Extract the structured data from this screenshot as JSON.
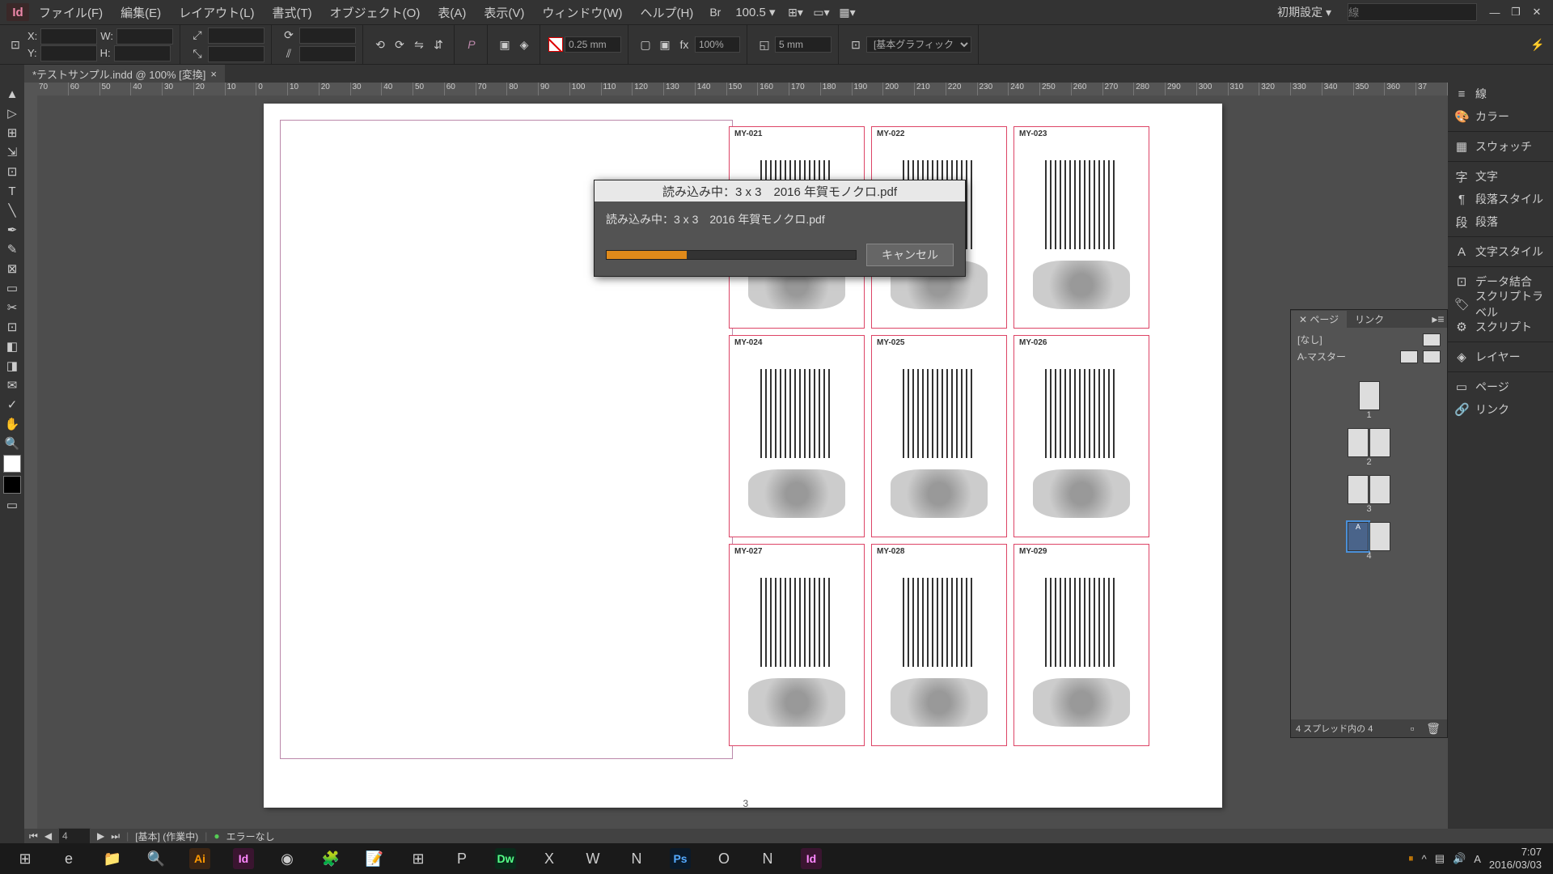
{
  "app": {
    "icon_label": "Id"
  },
  "menu": {
    "file": "ファイル(F)",
    "edit": "編集(E)",
    "layout": "レイアウト(L)",
    "type": "書式(T)",
    "object": "オブジェクト(O)",
    "table": "表(A)",
    "view": "表示(V)",
    "window": "ウィンドウ(W)",
    "help": "ヘルプ(H)"
  },
  "zoom": "100.5",
  "settings_label": "初期設定",
  "controls": {
    "stroke_val": "0.25 mm",
    "gap_val": "5 mm",
    "pct": "100%",
    "frame_style": "[基本グラフィックフ..."
  },
  "doc_tab": {
    "title": "*テストサンプル.indd @ 100% [変換]"
  },
  "ruler_marks": [
    "70",
    "60",
    "50",
    "40",
    "30",
    "20",
    "10",
    "0",
    "10",
    "20",
    "30",
    "40",
    "50",
    "60",
    "70",
    "80",
    "90",
    "100",
    "110",
    "120",
    "130",
    "140",
    "150",
    "160",
    "170",
    "180",
    "190",
    "200",
    "210",
    "220",
    "230",
    "240",
    "250",
    "260",
    "270",
    "280",
    "290",
    "300",
    "310",
    "320",
    "330",
    "340",
    "350",
    "360",
    "37"
  ],
  "cards": [
    {
      "id": "MY-021"
    },
    {
      "id": "MY-022"
    },
    {
      "id": "MY-023"
    },
    {
      "id": "MY-024"
    },
    {
      "id": "MY-025"
    },
    {
      "id": "MY-026"
    },
    {
      "id": "MY-027"
    },
    {
      "id": "MY-028"
    },
    {
      "id": "MY-029"
    }
  ],
  "page_num": "3",
  "panels": {
    "line": "線",
    "color": "カラー",
    "swatches": "スウォッチ",
    "character": "文字",
    "para_styles": "段落スタイル",
    "paragraph": "段落",
    "char_styles": "文字スタイル",
    "data_merge": "データ結合",
    "script_label": "スクリプトラベル",
    "scripts": "スクリプト",
    "layers": "レイヤー",
    "pages": "ページ",
    "links": "リンク"
  },
  "pages_panel": {
    "tab_pages": "ページ",
    "tab_links": "リンク",
    "master_none": "[なし]",
    "master_a": "A-マスター",
    "thumb_labels": [
      "1",
      "2",
      "3",
      "4"
    ],
    "footer": "4 スプレッド内の 4"
  },
  "dialog": {
    "title": "読み込み中：3 x 3　2016 年賀モノクロ.pdf",
    "message": "読み込み中：3 x 3　2016 年賀モノクロ.pdf",
    "cancel": "キャンセル"
  },
  "status": {
    "page_field": "4",
    "style": "[基本] (作業中)",
    "errors": "エラーなし"
  },
  "tray": {
    "time": "7:07",
    "date": "2016/03/03",
    "lang": "A"
  },
  "taskbar_apps": [
    "⊞",
    "e",
    "📁",
    "🔍",
    "Ai",
    "Id",
    "◉",
    "🧩",
    "📝",
    "⊞",
    "P",
    "Dw",
    "X",
    "W",
    "N",
    "Ps",
    "O",
    "N",
    "Id"
  ]
}
